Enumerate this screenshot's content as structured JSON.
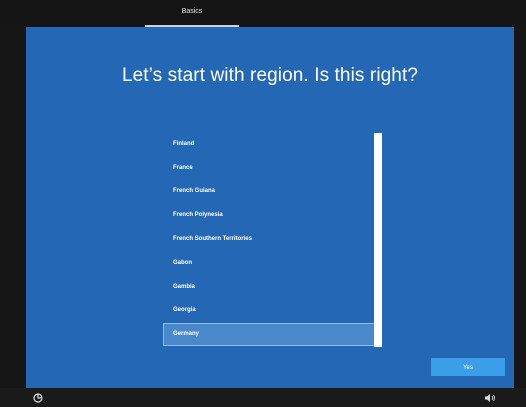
{
  "header": {
    "tab_label": "Basics"
  },
  "main": {
    "title": "Let’s start with region. Is this right?",
    "regions": [
      "Finland",
      "France",
      "French Guiana",
      "French Polynesia",
      "French Southern Territories",
      "Gabon",
      "Gambia",
      "Georgia",
      "Germany"
    ],
    "selected_region": "Germany",
    "yes_label": "Yes"
  },
  "footer": {
    "left_icon": "ease-of-access-icon",
    "right_icon": "volume-icon"
  },
  "colors": {
    "background": "#2468b5",
    "selected_item": "#4a88cc",
    "accent_button": "#3b9ee8"
  }
}
